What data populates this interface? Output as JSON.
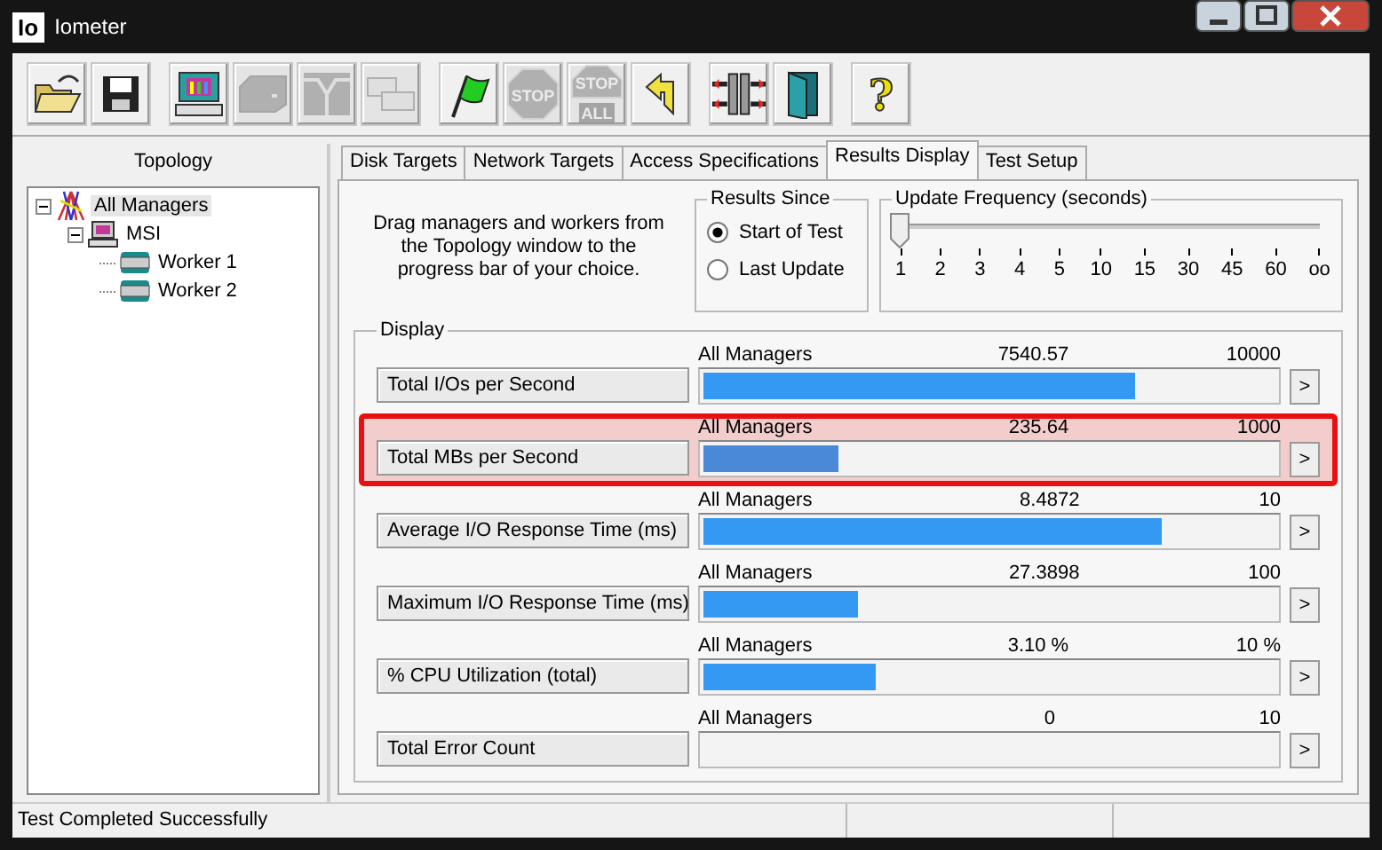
{
  "window": {
    "logo": "Io",
    "title": "Iometer"
  },
  "toolbar": [
    {
      "buttons": [
        {
          "kind": "open",
          "disabled": false
        },
        {
          "kind": "save",
          "disabled": false
        }
      ]
    },
    {
      "buttons": [
        {
          "kind": "computer",
          "disabled": false
        },
        {
          "kind": "disk",
          "disabled": true
        },
        {
          "kind": "split",
          "disabled": true
        },
        {
          "kind": "boxes",
          "disabled": true
        }
      ]
    },
    {
      "buttons": [
        {
          "kind": "flag",
          "disabled": false
        },
        {
          "kind": "stop",
          "disabled": true,
          "label": "STOP"
        },
        {
          "kind": "stopall",
          "disabled": true,
          "label": "STOP",
          "sublabel": "ALL"
        },
        {
          "kind": "reset",
          "disabled": false
        }
      ]
    },
    {
      "buttons": [
        {
          "kind": "connect",
          "disabled": false
        },
        {
          "kind": "exit",
          "disabled": false
        }
      ]
    },
    {
      "buttons": [
        {
          "kind": "help",
          "disabled": false,
          "label": "?"
        }
      ]
    }
  ],
  "topology": {
    "title": "Topology",
    "tree": [
      {
        "label": "All Managers",
        "kind": "all",
        "selected": true,
        "expanded": true,
        "children": [
          {
            "label": "MSI",
            "kind": "manager",
            "selected": false,
            "expanded": true,
            "children": [
              {
                "label": "Worker 1",
                "kind": "worker",
                "selected": false
              },
              {
                "label": "Worker 2",
                "kind": "worker",
                "selected": false
              }
            ]
          }
        ]
      }
    ]
  },
  "tabs": [
    {
      "label": "Disk Targets",
      "selected": false
    },
    {
      "label": "Network Targets",
      "selected": false
    },
    {
      "label": "Access Specifications",
      "selected": false
    },
    {
      "label": "Results Display",
      "selected": true
    },
    {
      "label": "Test Setup",
      "selected": false
    }
  ],
  "instructions": "Drag managers and workers from the Topology window to the progress bar of your choice.",
  "results_since": {
    "title": "Results Since",
    "options": [
      {
        "label": "Start of Test",
        "selected": true
      },
      {
        "label": "Last Update",
        "selected": false
      }
    ]
  },
  "update_frequency": {
    "title": "Update Frequency (seconds)",
    "level": 0,
    "ticks": [
      "1",
      "2",
      "3",
      "4",
      "5",
      "10",
      "15",
      "30",
      "45",
      "60",
      "oo"
    ]
  },
  "display": {
    "title": "Display",
    "rows": [
      {
        "metric": "Total I/Os per Second",
        "source": "All Managers",
        "value": "7540.57",
        "max": "10000",
        "level": 0.754,
        "highlighted": false,
        "button": ">"
      },
      {
        "metric": "Total MBs per Second",
        "source": "All Managers",
        "value": "235.64",
        "max": "1000",
        "level": 0.236,
        "highlighted": true,
        "button": ">"
      },
      {
        "metric": "Average I/O Response Time (ms)",
        "source": "All Managers",
        "value": "8.4872",
        "max": "10",
        "level": 0.8,
        "highlighted": false,
        "button": ">"
      },
      {
        "metric": "Maximum I/O Response Time (ms)",
        "source": "All Managers",
        "value": "27.3898",
        "max": "100",
        "level": 0.27,
        "highlighted": false,
        "button": ">"
      },
      {
        "metric": "% CPU Utilization (total)",
        "source": "All Managers",
        "value": "3.10 %",
        "max": "10 %",
        "level": 0.3,
        "highlighted": false,
        "button": ">"
      },
      {
        "metric": "Total Error Count",
        "source": "All Managers",
        "value": "0",
        "max": "10",
        "level": 0,
        "highlighted": false,
        "button": ">"
      }
    ]
  },
  "status_bar": {
    "message": "Test Completed Successfully"
  }
}
